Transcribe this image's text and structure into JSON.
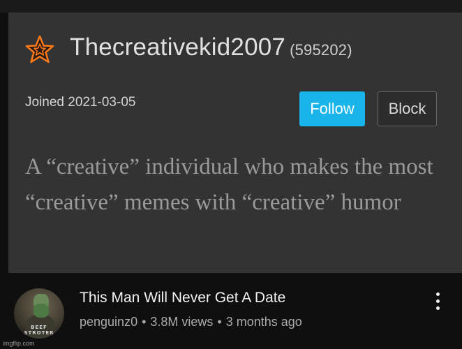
{
  "profile": {
    "username": "Thecreativekid2007",
    "points": "(595202)",
    "joined": "Joined 2021-03-05",
    "follow_label": "Follow",
    "block_label": "Block",
    "bio": "A “creative” individual who makes the most “creative” memes with “creative” humor",
    "rank_icon": "star-icon"
  },
  "video": {
    "title": "This Man Will Never Get A Date",
    "channel": "penguinz0",
    "views": "3.8M views",
    "age": "3 months ago",
    "separator": "•",
    "thumb_caption": "BEEF STROTER"
  },
  "watermark": "imgflip.com",
  "colors": {
    "card_bg": "#333333",
    "follow_bg": "#18b4ea",
    "star_stroke": "#ff7a1a",
    "page_bg": "#0f0f0f"
  }
}
